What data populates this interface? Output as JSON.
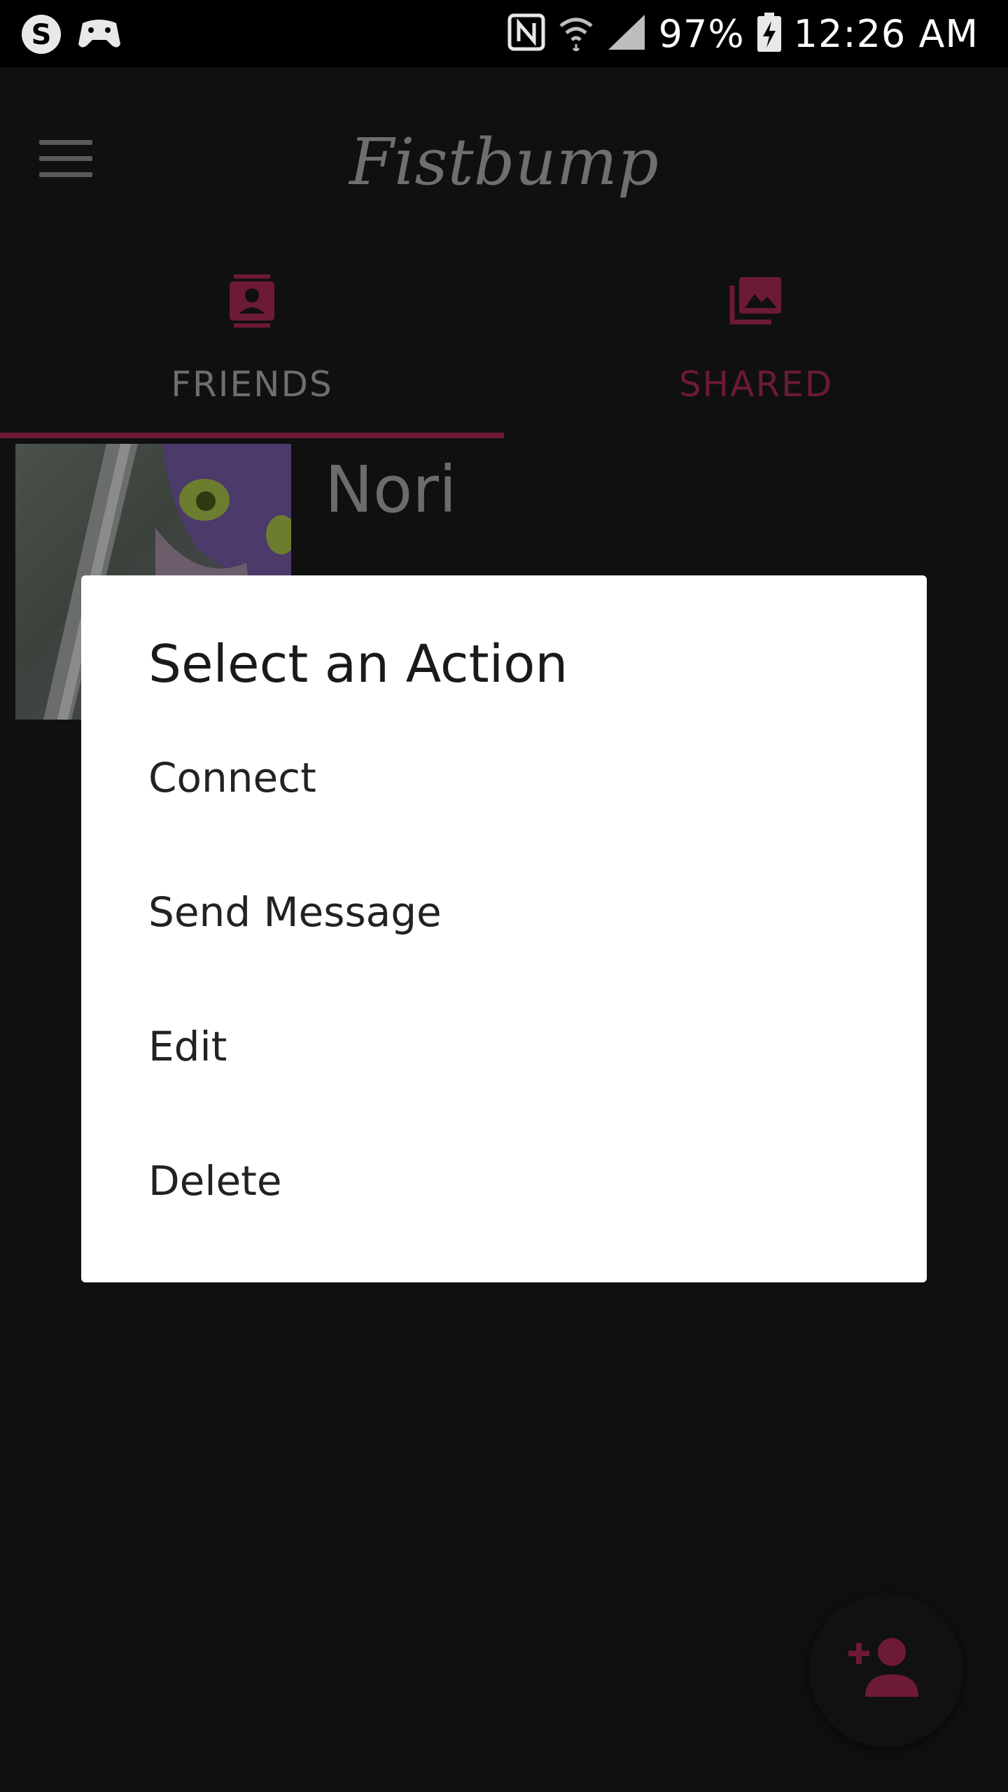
{
  "status_bar": {
    "battery": "97%",
    "time": "12:26 AM",
    "left_icons": [
      "skype-icon",
      "game-controller-icon"
    ],
    "right_icons": [
      "nfc-icon",
      "wifi-icon",
      "signal-icon",
      "battery-charging-icon"
    ]
  },
  "app_bar": {
    "title": "Fistbump",
    "menu_icon": "hamburger-menu-icon"
  },
  "tabs": [
    {
      "label": "FRIENDS",
      "icon": "contact-card-icon",
      "selected": true
    },
    {
      "label": "SHARED",
      "icon": "photo-library-icon",
      "selected": false
    }
  ],
  "friends": [
    {
      "name": "Nori"
    }
  ],
  "dialog": {
    "title": "Select an Action",
    "options": [
      "Connect",
      "Send Message",
      "Edit",
      "Delete"
    ]
  },
  "fab": {
    "icon": "add-person-icon"
  },
  "colors": {
    "accent": "#6d1a35",
    "background": "#101010",
    "dialog": "#ffffff"
  }
}
